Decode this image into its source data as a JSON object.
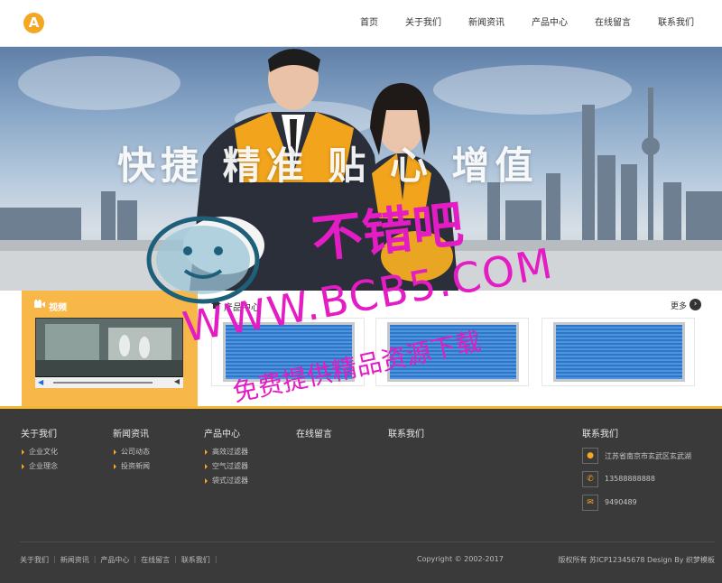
{
  "header": {
    "logo_letter": "A",
    "nav": [
      "首页",
      "关于我们",
      "新闻资讯",
      "产品中心",
      "在线留言",
      "联系我们"
    ]
  },
  "banner": {
    "slogan": "快捷 精准 贴 心 增值"
  },
  "video": {
    "title": "视频"
  },
  "products": {
    "title": "产品中心",
    "more": "更多",
    "more_icon": "›"
  },
  "footer": {
    "columns": [
      {
        "title": "关于我们",
        "items": [
          "企业文化",
          "企业理念"
        ]
      },
      {
        "title": "新闻资讯",
        "items": [
          "公司动态",
          "投资新闻"
        ]
      },
      {
        "title": "产品中心",
        "items": [
          "高效过滤器",
          "空气过滤器",
          "袋式过滤器"
        ]
      },
      {
        "title": "在线留言",
        "items": []
      },
      {
        "title": "联系我们",
        "items": []
      }
    ],
    "contact": {
      "title": "联系我们",
      "address": "江苏省南京市玄武区玄武湖",
      "phone": "13588888888",
      "fax": "9490489"
    },
    "bottom_links": [
      "关于我们",
      "新闻资讯",
      "产品中心",
      "在线留言",
      "联系我们"
    ],
    "copyright": "Copyright © 2002-2017",
    "icp": "版权所有 苏ICP12345678 Design By 织梦模板"
  },
  "watermark": {
    "line1": "不错吧",
    "line2": "WWW.BCB5.COM",
    "line3": "免费提供精品资源下载"
  },
  "colors": {
    "accent": "#f5a623",
    "footer_bg": "#3a3a3a",
    "watermark": "#e31cc4"
  }
}
